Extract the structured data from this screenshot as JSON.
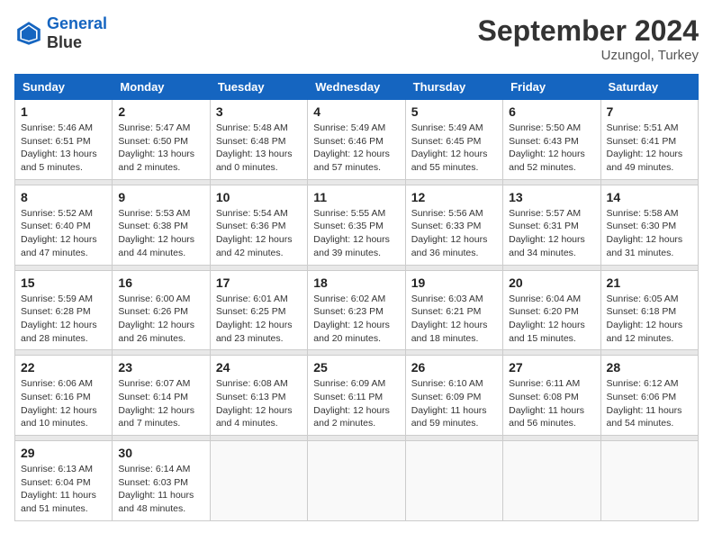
{
  "header": {
    "logo_line1": "General",
    "logo_line2": "Blue",
    "month": "September 2024",
    "location": "Uzungol, Turkey"
  },
  "days_of_week": [
    "Sunday",
    "Monday",
    "Tuesday",
    "Wednesday",
    "Thursday",
    "Friday",
    "Saturday"
  ],
  "weeks": [
    [
      {
        "day": "1",
        "sunrise": "Sunrise: 5:46 AM",
        "sunset": "Sunset: 6:51 PM",
        "daylight": "Daylight: 13 hours and 5 minutes."
      },
      {
        "day": "2",
        "sunrise": "Sunrise: 5:47 AM",
        "sunset": "Sunset: 6:50 PM",
        "daylight": "Daylight: 13 hours and 2 minutes."
      },
      {
        "day": "3",
        "sunrise": "Sunrise: 5:48 AM",
        "sunset": "Sunset: 6:48 PM",
        "daylight": "Daylight: 13 hours and 0 minutes."
      },
      {
        "day": "4",
        "sunrise": "Sunrise: 5:49 AM",
        "sunset": "Sunset: 6:46 PM",
        "daylight": "Daylight: 12 hours and 57 minutes."
      },
      {
        "day": "5",
        "sunrise": "Sunrise: 5:49 AM",
        "sunset": "Sunset: 6:45 PM",
        "daylight": "Daylight: 12 hours and 55 minutes."
      },
      {
        "day": "6",
        "sunrise": "Sunrise: 5:50 AM",
        "sunset": "Sunset: 6:43 PM",
        "daylight": "Daylight: 12 hours and 52 minutes."
      },
      {
        "day": "7",
        "sunrise": "Sunrise: 5:51 AM",
        "sunset": "Sunset: 6:41 PM",
        "daylight": "Daylight: 12 hours and 49 minutes."
      }
    ],
    [
      {
        "day": "8",
        "sunrise": "Sunrise: 5:52 AM",
        "sunset": "Sunset: 6:40 PM",
        "daylight": "Daylight: 12 hours and 47 minutes."
      },
      {
        "day": "9",
        "sunrise": "Sunrise: 5:53 AM",
        "sunset": "Sunset: 6:38 PM",
        "daylight": "Daylight: 12 hours and 44 minutes."
      },
      {
        "day": "10",
        "sunrise": "Sunrise: 5:54 AM",
        "sunset": "Sunset: 6:36 PM",
        "daylight": "Daylight: 12 hours and 42 minutes."
      },
      {
        "day": "11",
        "sunrise": "Sunrise: 5:55 AM",
        "sunset": "Sunset: 6:35 PM",
        "daylight": "Daylight: 12 hours and 39 minutes."
      },
      {
        "day": "12",
        "sunrise": "Sunrise: 5:56 AM",
        "sunset": "Sunset: 6:33 PM",
        "daylight": "Daylight: 12 hours and 36 minutes."
      },
      {
        "day": "13",
        "sunrise": "Sunrise: 5:57 AM",
        "sunset": "Sunset: 6:31 PM",
        "daylight": "Daylight: 12 hours and 34 minutes."
      },
      {
        "day": "14",
        "sunrise": "Sunrise: 5:58 AM",
        "sunset": "Sunset: 6:30 PM",
        "daylight": "Daylight: 12 hours and 31 minutes."
      }
    ],
    [
      {
        "day": "15",
        "sunrise": "Sunrise: 5:59 AM",
        "sunset": "Sunset: 6:28 PM",
        "daylight": "Daylight: 12 hours and 28 minutes."
      },
      {
        "day": "16",
        "sunrise": "Sunrise: 6:00 AM",
        "sunset": "Sunset: 6:26 PM",
        "daylight": "Daylight: 12 hours and 26 minutes."
      },
      {
        "day": "17",
        "sunrise": "Sunrise: 6:01 AM",
        "sunset": "Sunset: 6:25 PM",
        "daylight": "Daylight: 12 hours and 23 minutes."
      },
      {
        "day": "18",
        "sunrise": "Sunrise: 6:02 AM",
        "sunset": "Sunset: 6:23 PM",
        "daylight": "Daylight: 12 hours and 20 minutes."
      },
      {
        "day": "19",
        "sunrise": "Sunrise: 6:03 AM",
        "sunset": "Sunset: 6:21 PM",
        "daylight": "Daylight: 12 hours and 18 minutes."
      },
      {
        "day": "20",
        "sunrise": "Sunrise: 6:04 AM",
        "sunset": "Sunset: 6:20 PM",
        "daylight": "Daylight: 12 hours and 15 minutes."
      },
      {
        "day": "21",
        "sunrise": "Sunrise: 6:05 AM",
        "sunset": "Sunset: 6:18 PM",
        "daylight": "Daylight: 12 hours and 12 minutes."
      }
    ],
    [
      {
        "day": "22",
        "sunrise": "Sunrise: 6:06 AM",
        "sunset": "Sunset: 6:16 PM",
        "daylight": "Daylight: 12 hours and 10 minutes."
      },
      {
        "day": "23",
        "sunrise": "Sunrise: 6:07 AM",
        "sunset": "Sunset: 6:14 PM",
        "daylight": "Daylight: 12 hours and 7 minutes."
      },
      {
        "day": "24",
        "sunrise": "Sunrise: 6:08 AM",
        "sunset": "Sunset: 6:13 PM",
        "daylight": "Daylight: 12 hours and 4 minutes."
      },
      {
        "day": "25",
        "sunrise": "Sunrise: 6:09 AM",
        "sunset": "Sunset: 6:11 PM",
        "daylight": "Daylight: 12 hours and 2 minutes."
      },
      {
        "day": "26",
        "sunrise": "Sunrise: 6:10 AM",
        "sunset": "Sunset: 6:09 PM",
        "daylight": "Daylight: 11 hours and 59 minutes."
      },
      {
        "day": "27",
        "sunrise": "Sunrise: 6:11 AM",
        "sunset": "Sunset: 6:08 PM",
        "daylight": "Daylight: 11 hours and 56 minutes."
      },
      {
        "day": "28",
        "sunrise": "Sunrise: 6:12 AM",
        "sunset": "Sunset: 6:06 PM",
        "daylight": "Daylight: 11 hours and 54 minutes."
      }
    ],
    [
      {
        "day": "29",
        "sunrise": "Sunrise: 6:13 AM",
        "sunset": "Sunset: 6:04 PM",
        "daylight": "Daylight: 11 hours and 51 minutes."
      },
      {
        "day": "30",
        "sunrise": "Sunrise: 6:14 AM",
        "sunset": "Sunset: 6:03 PM",
        "daylight": "Daylight: 11 hours and 48 minutes."
      },
      {
        "day": "",
        "sunrise": "",
        "sunset": "",
        "daylight": ""
      },
      {
        "day": "",
        "sunrise": "",
        "sunset": "",
        "daylight": ""
      },
      {
        "day": "",
        "sunrise": "",
        "sunset": "",
        "daylight": ""
      },
      {
        "day": "",
        "sunrise": "",
        "sunset": "",
        "daylight": ""
      },
      {
        "day": "",
        "sunrise": "",
        "sunset": "",
        "daylight": ""
      }
    ]
  ]
}
